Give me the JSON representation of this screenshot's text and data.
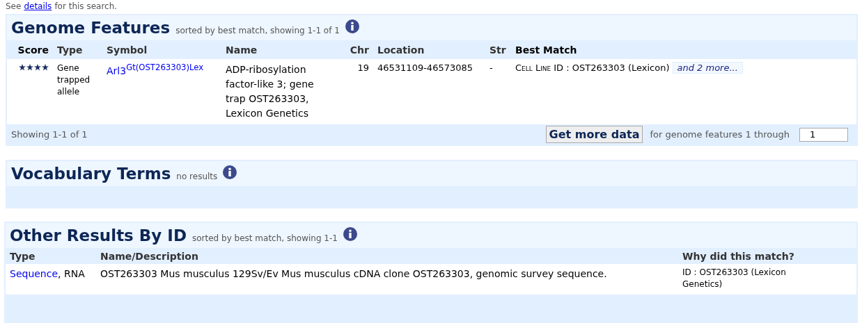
{
  "intro": {
    "before": "See",
    "link": "details",
    "after": "for this search."
  },
  "genome_features": {
    "title": "Genome Features",
    "subtitle": "sorted by best match, showing 1-1 of 1",
    "columns": [
      "Score",
      "Type",
      "Symbol",
      "Name",
      "Chr",
      "Location",
      "Str",
      "Best Match"
    ],
    "rows": [
      {
        "stars": 4,
        "type": "Gene trapped allele",
        "symbol": "Arl3$^{Gt(OST263303)Lex}$",
        "name": "ADP-ribosylation factor-like 3; gene trap OST263303, Lexicon Genetics",
        "chr": "19",
        "location": "46531109-46573085",
        "str": "-",
        "best_match_label": "Cell Line",
        "best_match": "ID : OST263303 (Lexicon)",
        "more": "and 2 more..."
      }
    ],
    "footer": "Showing 1-1 of 1",
    "button": "Get more data",
    "through_label": "for genome features 1 through",
    "through_value": "1"
  },
  "vocabulary_terms": {
    "title": "Vocabulary Terms",
    "subtitle": "no results"
  },
  "other_results": {
    "title": "Other Results By ID",
    "subtitle": "sorted by best match, showing 1-1",
    "columns": [
      "Type",
      "Name/Description",
      "Why did this match?"
    ],
    "rows": [
      {
        "type_link": "Sequence",
        "type_rest": ", RNA",
        "description": "OST263303 Mus musculus 129Sv/Ev Mus musculus cDNA clone OST263303, genomic survey sequence.",
        "why": "ID : OST263303 (Lexicon Genetics)"
      }
    ]
  }
}
